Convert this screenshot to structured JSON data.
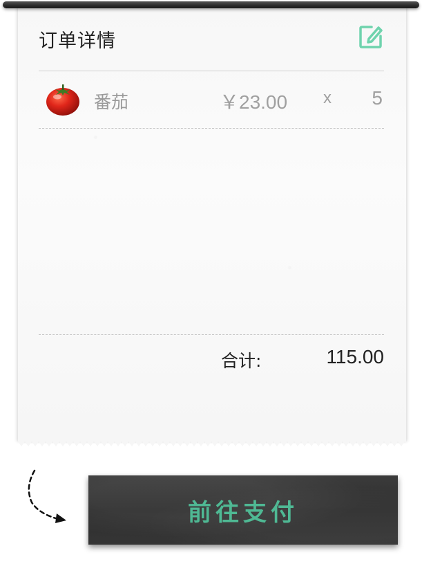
{
  "header": {
    "title": "订单详情",
    "edit_icon": "edit-icon"
  },
  "order": {
    "items": [
      {
        "icon": "tomato-icon",
        "name": "番茄",
        "price": "￥23.00",
        "times": "x",
        "quantity": "5"
      }
    ],
    "total_label": "合计:",
    "total_value": "115.00"
  },
  "footer": {
    "arrow_icon": "dashed-curved-arrow-icon",
    "pay_button_label": "前往支付"
  },
  "colors": {
    "accent": "#4fb994",
    "button_bg": "#333333",
    "text_dark": "#222222",
    "text_muted": "#9a9a9a"
  }
}
